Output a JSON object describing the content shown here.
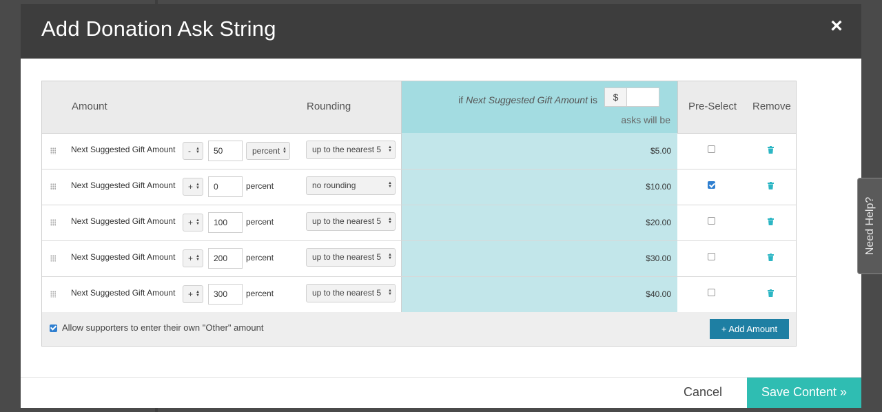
{
  "modal": {
    "title": "Add Donation Ask String",
    "close_label": "×"
  },
  "table": {
    "headers": {
      "amount": "Amount",
      "rounding": "Rounding",
      "if_prefix": "if ",
      "if_field": "Next Suggested Gift Amount",
      "if_suffix": " is",
      "currency": "$",
      "asks_will_be": "asks will be",
      "preselect": "Pre-Select",
      "remove": "Remove"
    },
    "rows": [
      {
        "label": "Next Suggested Gift Amount",
        "sign": "-",
        "value": "50",
        "unit": "percent",
        "unit_is_select": true,
        "rounding": "up to the nearest 5",
        "ask": "$5.00",
        "preselected": false
      },
      {
        "label": "Next Suggested Gift Amount",
        "sign": "+",
        "value": "0",
        "unit": "percent",
        "unit_is_select": false,
        "rounding": "no rounding",
        "ask": "$10.00",
        "preselected": true
      },
      {
        "label": "Next Suggested Gift Amount",
        "sign": "+",
        "value": "100",
        "unit": "percent",
        "unit_is_select": false,
        "rounding": "up to the nearest 5",
        "ask": "$20.00",
        "preselected": false
      },
      {
        "label": "Next Suggested Gift Amount",
        "sign": "+",
        "value": "200",
        "unit": "percent",
        "unit_is_select": false,
        "rounding": "up to the nearest 5",
        "ask": "$30.00",
        "preselected": false
      },
      {
        "label": "Next Suggested Gift Amount",
        "sign": "+",
        "value": "300",
        "unit": "percent",
        "unit_is_select": false,
        "rounding": "up to the nearest 5",
        "ask": "$40.00",
        "preselected": false
      }
    ],
    "allow_other_label": "Allow supporters to enter their own \"Other\" amount",
    "allow_other_checked": true,
    "add_amount_label": "+ Add Amount"
  },
  "footer": {
    "cancel_label": "Cancel",
    "save_label": "Save Content »"
  },
  "help_tab": {
    "label": "Need Help?"
  },
  "colors": {
    "header_bg": "#3d3d3d",
    "calc_column": "#c2e6ea",
    "calc_header": "#a3dce1",
    "add_button": "#1e7fa3",
    "save_button": "#2fbdb2",
    "trash_icon": "#2cb6c4",
    "checkbox_checked": "#2f7fd0"
  },
  "icons": {
    "close": "close-icon",
    "drag": "drag-handle-icon",
    "remove": "trash-icon",
    "select_arrows": "select-arrows-icon"
  }
}
